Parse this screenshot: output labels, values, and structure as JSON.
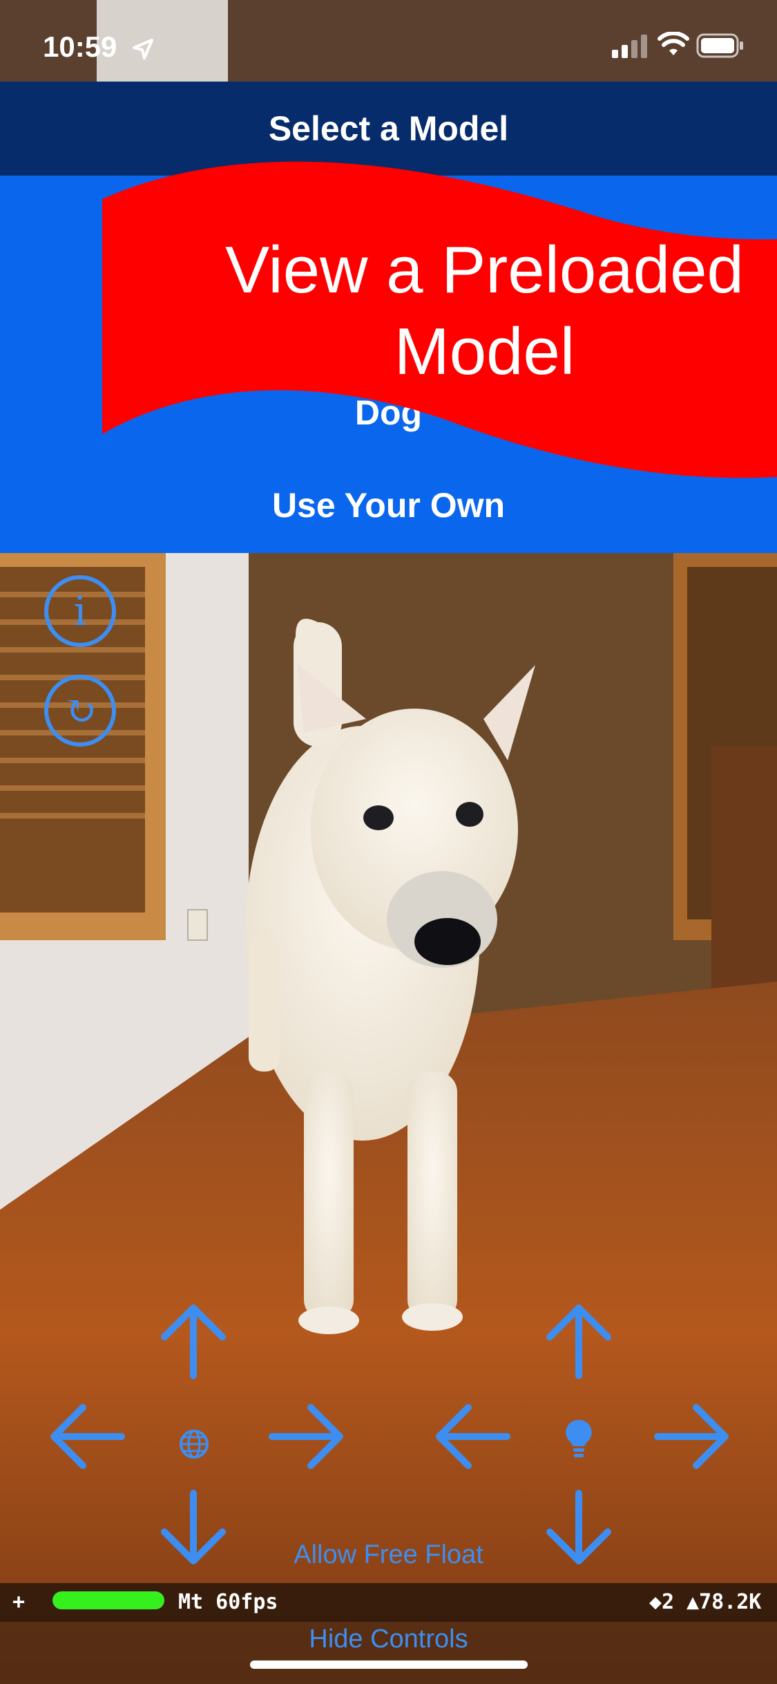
{
  "status_bar": {
    "time": "10:59"
  },
  "menu": {
    "header_title": "Select a Model",
    "items": [
      "Dog",
      "Use Your Own"
    ]
  },
  "banner": {
    "line1": "View a Preloaded",
    "line2": "Model"
  },
  "left_controls": {
    "info_symbol": "i",
    "reset_symbol": "↻"
  },
  "dpad_left_center_icon": "globe-icon",
  "dpad_right_center_icon": "lightbulb-icon",
  "free_float_label": "Allow Free Float",
  "stats": {
    "plus": "+",
    "fps_label": "Mt 60fps",
    "nodes": "◆2",
    "triangles": "▲78.2K",
    "frame_bar_fill": 1.0
  },
  "hide_controls_label": "Hide Controls",
  "colors": {
    "accent": "#3d8ef0",
    "menu_blue": "#0a66ec",
    "header_navy": "#062c6c",
    "banner_red": "#ff0000",
    "fps_green": "#36f01e"
  }
}
